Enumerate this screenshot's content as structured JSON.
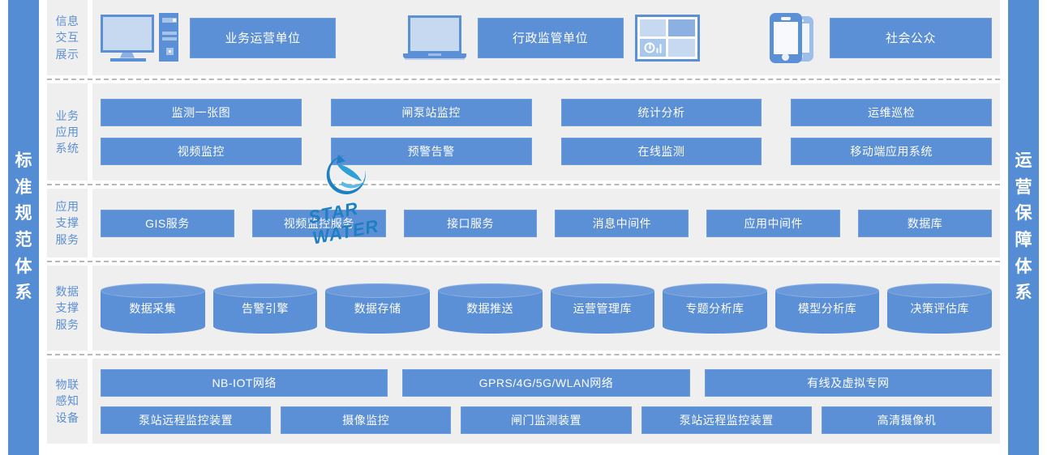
{
  "left_banner": {
    "name": "standard-specification-system",
    "chars": [
      "标",
      "准",
      "规",
      "范",
      "体",
      "系"
    ]
  },
  "right_banner": {
    "name": "operation-guarantee-system",
    "chars": [
      "运",
      "营",
      "保",
      "障",
      "体",
      "系"
    ]
  },
  "watermark": {
    "text": "STAR WATER",
    "color": "#1e7fc2"
  },
  "colors": {
    "banner_blue": "#548dd4",
    "box_blue": "#5b8fd6",
    "icon_light": "#c6d9f1",
    "panel_gray": "#efefef",
    "label_text": "#5b8fd6",
    "divider": "#b9b9b9"
  },
  "layers": [
    {
      "id": "info-interaction-display",
      "label": [
        "信",
        "息",
        "交",
        "互",
        "展",
        "示"
      ],
      "label_lines": [
        "信息",
        "交互",
        "展示"
      ],
      "devices": [
        {
          "icon": "desktop-computer-icon",
          "label": "业务运营单位"
        },
        {
          "icon": "laptop-icon",
          "label": "行政监管单位"
        },
        {
          "icon": "video-wall-dashboard-icon",
          "label": "社会公众"
        }
      ],
      "boxes": [
        "业务运营单位",
        "行政监管单位",
        "社会公众"
      ]
    },
    {
      "id": "business-application-system",
      "label_lines": [
        "业务",
        "应用",
        "系统"
      ],
      "rows": [
        [
          "监测一张图",
          "闸泵站监控",
          "统计分析",
          "运维巡检"
        ],
        [
          "视频监控",
          "预警告警",
          "在线监测",
          "移动端应用系统"
        ]
      ]
    },
    {
      "id": "application-support-service",
      "label_lines": [
        "应用",
        "支撑",
        "服务"
      ],
      "rows": [
        [
          "GIS服务",
          "视频监控服务",
          "接口服务",
          "消息中间件",
          "应用中间件",
          "数据库"
        ]
      ]
    },
    {
      "id": "data-support-service",
      "label_lines": [
        "数据",
        "支撑",
        "服务"
      ],
      "cylinders": [
        "数据采集",
        "告警引擎",
        "数据存储",
        "数据推送",
        "运营管理库",
        "专题分析库",
        "模型分析库",
        "决策评估库"
      ]
    },
    {
      "id": "iot-sensing-device",
      "label_lines": [
        "物联",
        "感知",
        "设备"
      ],
      "rows": [
        [
          "NB-IOT网络",
          "GPRS/4G/5G/WLAN网络",
          "有线及虚拟专网"
        ],
        [
          "泵站远程监控装置",
          "摄像监控",
          "闸门监测装置",
          "泵站远程监控装置",
          "高清摄像机"
        ]
      ]
    }
  ]
}
